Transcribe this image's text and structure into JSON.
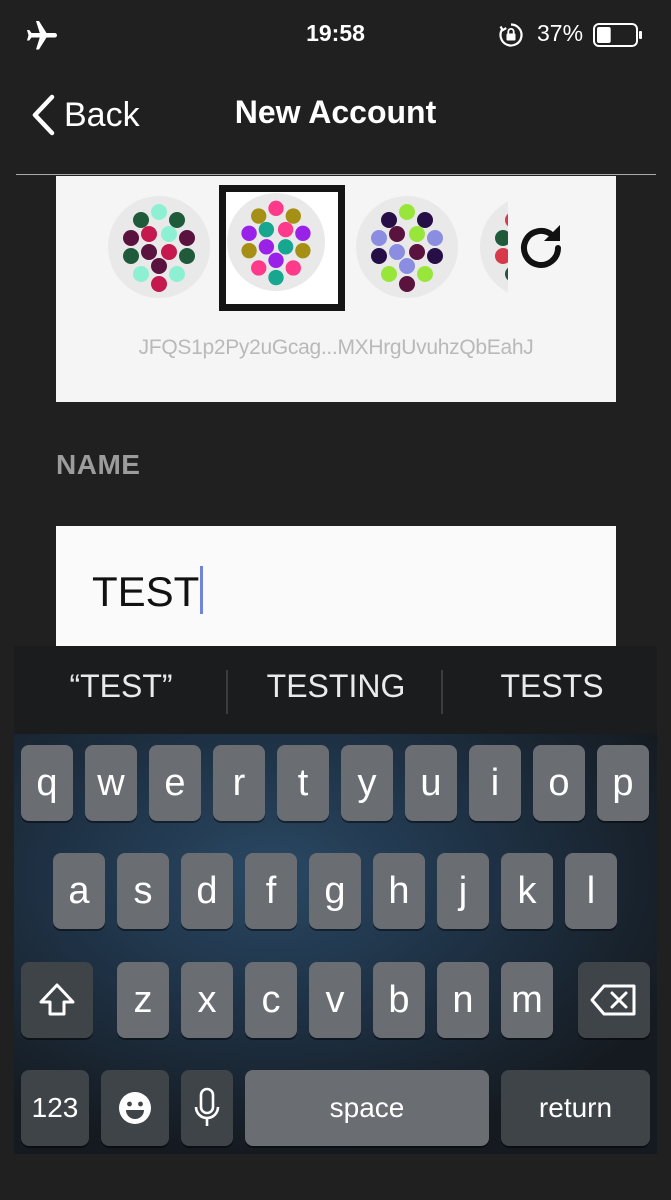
{
  "status_bar": {
    "time": "19:58",
    "battery_percent": "37%",
    "battery_level": 0.37,
    "icons": [
      "airplane-icon",
      "orientation-lock-icon",
      "battery-icon"
    ]
  },
  "nav": {
    "back_label": "Back",
    "title": "New Account"
  },
  "identicons": {
    "address": "JFQS1p2Py2uGcag...MXHrgUvuhzQbEahJ",
    "selected_index": 1,
    "palettes": [
      [
        "#8df0d2",
        "#1f5a3a",
        "#5a123f",
        "#c4184f"
      ],
      [
        "#ff3a8a",
        "#a58f14",
        "#9a22e8",
        "#17a68f"
      ],
      [
        "#99e63b",
        "#260f47",
        "#8b8ee0",
        "#5a123f"
      ],
      [
        "#1f5a3a",
        "#d83a4c"
      ]
    ]
  },
  "form": {
    "name_label": "NAME",
    "name_value": "TEST"
  },
  "keyboard": {
    "suggestions": [
      "“TEST”",
      "TESTING",
      "TESTS"
    ],
    "row1": [
      "q",
      "w",
      "e",
      "r",
      "t",
      "y",
      "u",
      "i",
      "o",
      "p"
    ],
    "row2": [
      "a",
      "s",
      "d",
      "f",
      "g",
      "h",
      "j",
      "k",
      "l"
    ],
    "row3": [
      "z",
      "x",
      "c",
      "v",
      "b",
      "n",
      "m"
    ],
    "numbers_label": "123",
    "space_label": "space",
    "return_label": "return"
  },
  "colors": {
    "background": "#202020",
    "caret": "#6f86d8",
    "key": "#6a6e73",
    "key_dark": "#3f4449"
  }
}
